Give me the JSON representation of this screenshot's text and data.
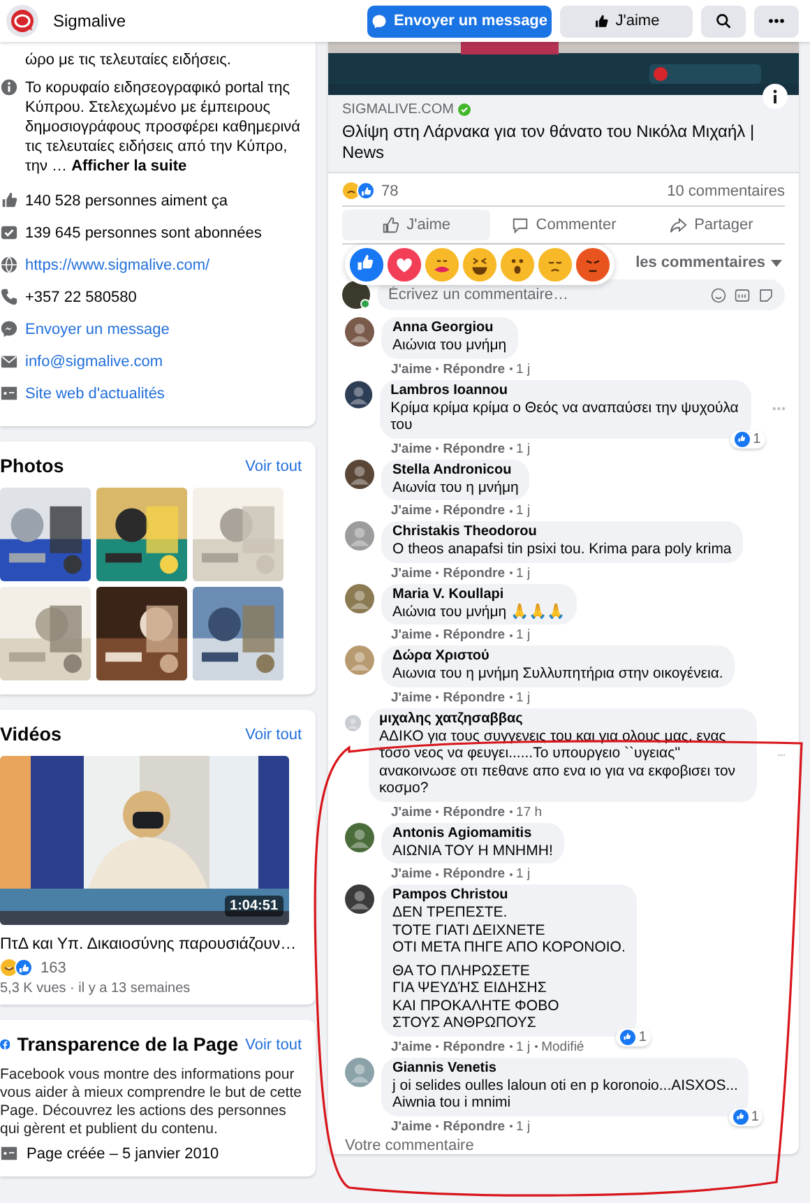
{
  "header": {
    "page_name": "Sigmalive",
    "buttons": [
      {
        "kind": "message",
        "label": "Envoyer un message"
      },
      {
        "kind": "like",
        "label": "J'aime"
      },
      {
        "kind": "search"
      },
      {
        "kind": "more"
      }
    ]
  },
  "about": {
    "description_tail": "ώρο με τις τελευταίες ειδήσεις.",
    "intro": "Το κορυφαίο ειδησεογραφικό portal της Κύπρου. Στελεχωμένο με έμπειρους δημοσιογράφους προσφέρει καθημερινά τις τελευταίες ειδήσεις από την Κύπρο, την …",
    "see_more": "Afficher la suite",
    "items": [
      {
        "kind": "likes",
        "text": "140 528 personnes aiment ça",
        "link": false
      },
      {
        "kind": "follows",
        "text": "139 645 personnes sont abonnées",
        "link": false
      },
      {
        "kind": "website",
        "text": "https://www.sigmalive.com/",
        "link": true
      },
      {
        "kind": "phone",
        "text": "+357 22 580580",
        "link": false
      },
      {
        "kind": "messenger",
        "text": "Envoyer un message",
        "link": true
      },
      {
        "kind": "mail",
        "text": "info@sigmalive.com",
        "link": true
      },
      {
        "kind": "category",
        "text": "Site web d'actualités",
        "link": true
      }
    ]
  },
  "photos": {
    "title": "Photos",
    "see_all": "Voir tout"
  },
  "videos": {
    "title": "Vidéos",
    "see_all": "Voir tout",
    "duration": "1:04:51",
    "video_title": "ΠτΔ και Υπ. Δικαιοσύνης παρουσιάζουν…",
    "reaction_count": "163",
    "views": "5,3 K vues · il y a 13 semaines"
  },
  "transparency": {
    "title": "Transparence de la Page",
    "see_all": "Voir tout",
    "text": "Facebook vous montre des informations pour vous aider à mieux comprendre le but de cette Page. Découvrez les actions des personnes qui gèrent et publient du contenu.",
    "created": "Page créée – 5 janvier 2010"
  },
  "post": {
    "source": "SIGMALIVE.COM",
    "verified": true,
    "title": "Θλίψη στη Λάρνακα για τον θάνατο του Νικόλα Μιχαήλ | News",
    "reaction_count": "78",
    "comment_count": "10 commentaires",
    "actions": [
      {
        "kind": "like",
        "label": "J'aime",
        "hovered": true
      },
      {
        "kind": "comment",
        "label": "Commenter",
        "hovered": false
      },
      {
        "kind": "share",
        "label": "Partager",
        "hovered": false
      }
    ],
    "reaction_picker": [
      {
        "kind": "like"
      },
      {
        "kind": "love"
      },
      {
        "kind": "care"
      },
      {
        "kind": "haha"
      },
      {
        "kind": "wow"
      },
      {
        "kind": "sad"
      },
      {
        "kind": "angry"
      }
    ],
    "sort_label": "les commentaires",
    "comment_placeholder": "Écrivez un commentaire…"
  },
  "comments": [
    {
      "name": "Anna Georgiou",
      "text": "Αιώνια του μνήμη",
      "like": "J'aime",
      "reply": "Répondre",
      "time": "1 j",
      "menu_visible": false
    },
    {
      "name": "Lambros Ioannou",
      "text": "Κρίμα κρίμα κρίμα ο Θεός να αναπαύσει την ψυχούλα του",
      "like": "J'aime",
      "reply": "Répondre",
      "time": "1 j",
      "reactions": "1",
      "menu_visible": true
    },
    {
      "name": "Stella Andronicou",
      "text": "Αιωνία του η μνήμη",
      "like": "J'aime",
      "reply": "Répondre",
      "time": "1 j",
      "menu_visible": false
    },
    {
      "name": "Christakis Theodorou",
      "text": "O theos anapafsi tin psixi tou. Krima para poly krima",
      "like": "J'aime",
      "reply": "Répondre",
      "time": "1 j",
      "menu_visible": false
    },
    {
      "name": "Maria V. Koullapi",
      "text": "Αιώνια του μνήμη 🙏🙏🙏",
      "like": "J'aime",
      "reply": "Répondre",
      "time": "1 j",
      "menu_visible": false
    },
    {
      "name": "Δώρα Χριστού",
      "text": "Αιωνια του η μνήμη Συλλυπητήρια στην οικογένεια.",
      "like": "J'aime",
      "reply": "Répondre",
      "time": "1 j",
      "menu_visible": false
    },
    {
      "name": "μιχαλης χατζησαββας",
      "text": "ΑΔΙΚΟ για τους συγγενεις του και για ολους μας, ενας τοσο νεος να φευγει......Το υπουργειο ``υγειας'' ανακοινωσε οτι πεθανε απο ενα ιο για να εκφοβισει τον κοσμο?",
      "like": "J'aime",
      "reply": "Répondre",
      "time": "17 h",
      "menu_visible": true
    },
    {
      "name": "Antonis Agiomamitis",
      "text": "ΑΙΩΝΙΑ ΤΟΥ Η ΜΝΗΜΗ!",
      "like": "J'aime",
      "reply": "Répondre",
      "time": "1 j",
      "menu_visible": false
    },
    {
      "name": "Pampos Christou",
      "text": "ΔΕΝ ΤΡΕΠΕΣΤΕ.\nΤΟΤΕ ΓΙΑΤΙ ΔΕΙΧΝΕΤΕ\nΟΤΙ ΜΕΤΑ ΠΗΓΕ ΑΠΟ ΚΟΡΟΝΟΙΟ.\n\nΘΑ ΤΟ ΠΛΗΡΩΣΕΤΕ\nΓΙΑ ΨΕΥΔΉΣ ΕΙΔΗΣΗΣ\nΚΑΙ ΠΡΟΚΑΛΗΤΕ ΦΟΒΟ\nΣΤΟΥΣ ΑΝΘΡΩΠΟΥΣ",
      "like": "J'aime",
      "reply": "Répondre",
      "time": "1 j",
      "edited": "Modifié",
      "reactions": "1",
      "menu_visible": false
    },
    {
      "name": "Giannis Venetis",
      "text": "j oi selides oulles laloun oti en p koronoio...AISXOS...\nAiwnia tou i mnimi",
      "like": "J'aime",
      "reply": "Répondre",
      "time": "1 j",
      "reactions": "1",
      "menu_visible": false
    }
  ],
  "reply_placeholder": "Votre commentaire",
  "annotation": {
    "kind": "outline"
  }
}
